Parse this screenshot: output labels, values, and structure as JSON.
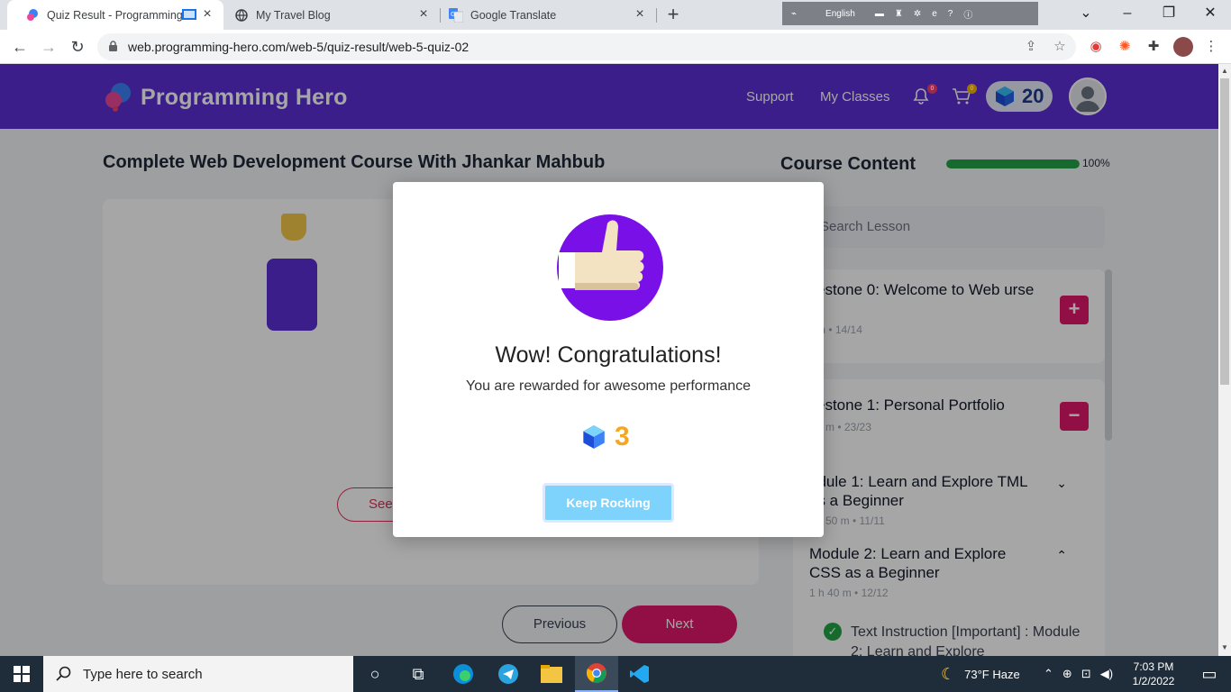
{
  "browser": {
    "tabs": [
      {
        "title": "Quiz Result - Programming H",
        "favicon": "programming-hero-logo"
      },
      {
        "title": "My Travel Blog",
        "favicon": "globe-icon"
      },
      {
        "title": "Google Translate",
        "favicon": "google-translate-icon"
      }
    ],
    "language_bar": {
      "label": "English"
    },
    "url": "web.programming-hero.com/web-5/quiz-result/web-5-quiz-02"
  },
  "header": {
    "brand": "Programming Hero",
    "nav": [
      "Support",
      "My Classes"
    ],
    "notifications_count": "0",
    "cart_count": "0",
    "gems": "20",
    "accent": "#5b2ed3"
  },
  "main": {
    "course_title": "Complete Web Development Course With Jhankar Mahbub",
    "see_button_label": "See",
    "prev_label": "Previous",
    "next_label": "Next"
  },
  "course_content": {
    "title": "Course Content",
    "progress_percent": 100,
    "progress_label": "100%",
    "search_placeholder": "Search Lesson",
    "milestones": [
      {
        "title": "estone 0: Welcome to Web urse",
        "meta": "m •  14/14",
        "toggle": "+"
      },
      {
        "title": "estone 1: Personal Portfolio",
        "meta": "0 m •  23/23",
        "toggle": "−"
      }
    ],
    "modules": [
      {
        "title": "odule 1: Learn and Explore TML as a Beginner",
        "meta": "50 m •  11/11",
        "chevron": "down"
      },
      {
        "title": "Module 2: Learn and Explore CSS as a Beginner",
        "meta": "1 h 40 m •  12/12",
        "chevron": "up"
      }
    ],
    "lesson": {
      "title": "Text Instruction [Important] : Module 2: Learn and Explore"
    }
  },
  "modal": {
    "title": "Wow! Congratulations!",
    "subtitle": "You are rewarded for awesome performance",
    "reward_value": "3",
    "button_label": "Keep Rocking"
  },
  "taskbar": {
    "search_placeholder": "Type here to search",
    "weather": "73°F  Haze",
    "time": "7:03 PM",
    "date": "1/2/2022"
  }
}
